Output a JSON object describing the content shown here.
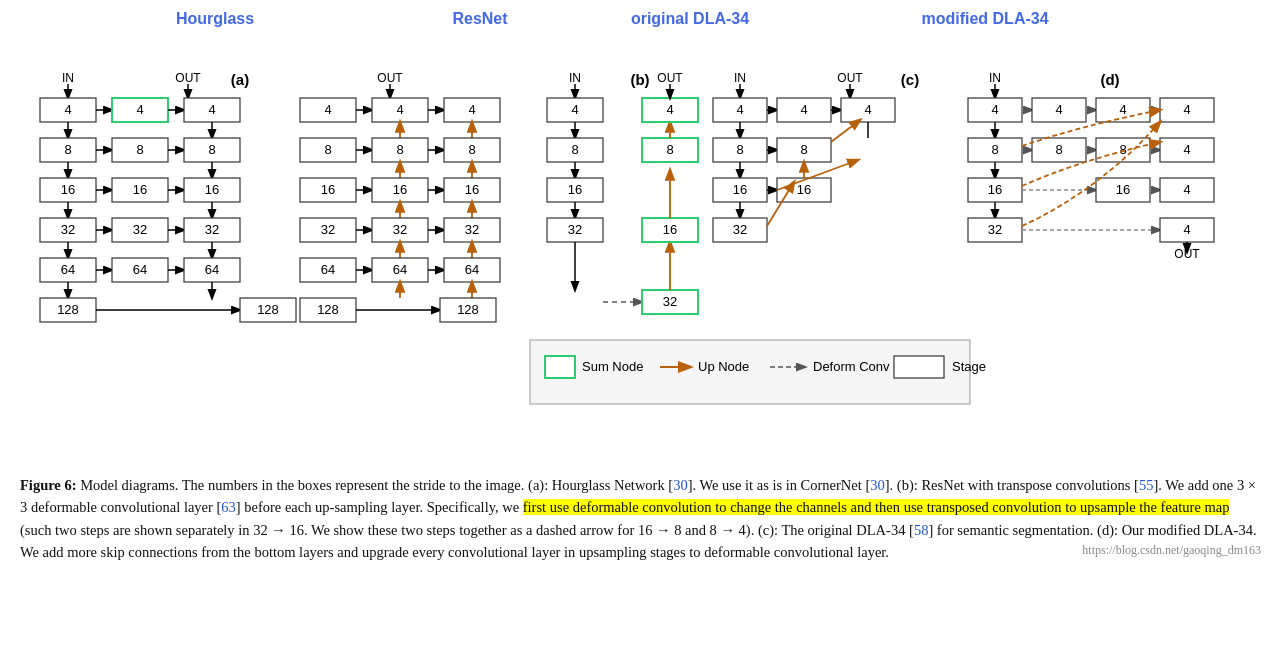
{
  "titles": {
    "hourglass": "Hourglass",
    "resnet": "ResNet",
    "original_dla": "original DLA-34",
    "modified_dla": "modified DLA-34"
  },
  "labels": {
    "a": "(a)",
    "b": "(b)",
    "c": "(c)",
    "d": "(d)",
    "in": "IN",
    "out": "OUT"
  },
  "legend": {
    "sum_node": "Sum Node",
    "up_node": "Up Node",
    "deform_conv": "Deform Conv",
    "stage": "Stage"
  },
  "caption": {
    "figure": "Figure 6:",
    "text1": " Model diagrams. The numbers in the boxes represent the stride to the image. (a): Hourglass Network [",
    "ref1": "30",
    "text2": "]. We use it as is in CornerNet [",
    "ref2": "30",
    "text3": "]. (b): ResNet with transpose convolutions [",
    "ref3": "55",
    "text4": "]. We add one 3 × 3 deformable convolutional layer [",
    "ref4": "63",
    "text5": "] before each up-sampling layer. Specifically, we ",
    "highlight": "first use deformable convolution to change the channels and then use transposed convolution to upsample the feature map",
    "text6": " (such two steps are shown separately in 32 → 16. We show these two steps together as a dashed arrow for 16 → 8 and 8 → 4). (c): The original DLA-34 [",
    "ref5": "58",
    "text7": "] for semantic segmentation. (d): Our modified DLA-34. We add more skip connections from the bottom layers and upgrade every convolutional layer in upsampling stages to deformable convolutional layer.",
    "url": "https://blog.csdn.net/gaoqing_dm163"
  }
}
